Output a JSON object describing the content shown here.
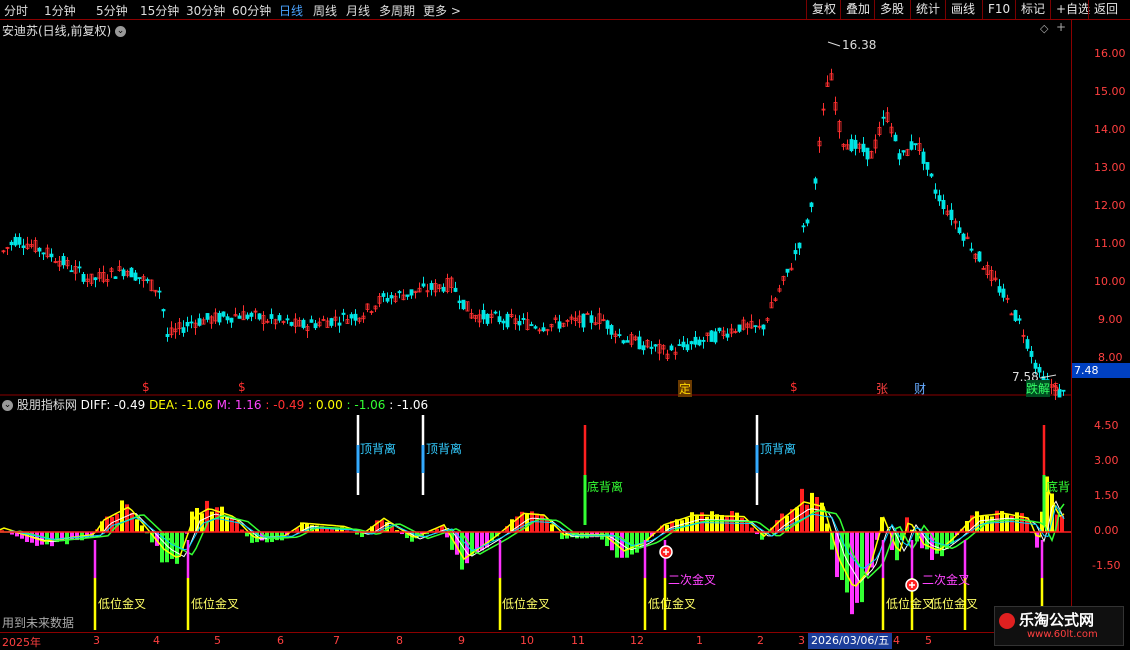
{
  "toolbar": {
    "periods": [
      "分时",
      "1分钟",
      "5分钟",
      "15分钟",
      "30分钟",
      "60分钟",
      "日线",
      "周线",
      "月线",
      "多周期",
      "更多"
    ],
    "active_period": "日线",
    "buttons": [
      "复权",
      "叠加",
      "多股",
      "统计",
      "画线",
      "F10",
      "标记",
      "+自选",
      "返回"
    ]
  },
  "main": {
    "title": "安迪苏(日线,前复权)",
    "high_label": "16.38",
    "low_label": "7.58",
    "last_price": "7.48",
    "y_ticks": [
      "16.00",
      "15.00",
      "14.00",
      "13.00",
      "12.00",
      "11.00",
      "10.00",
      "9.00",
      "8.00"
    ],
    "markers": [
      {
        "text": "$",
        "color": "#ff3030"
      },
      {
        "text": "$",
        "color": "#ff3030"
      },
      {
        "text": "定",
        "color": "#ffd700"
      },
      {
        "text": "$",
        "color": "#ff3030"
      },
      {
        "text": "张",
        "color": "#ff4040"
      },
      {
        "text": "财",
        "color": "#66aaff"
      },
      {
        "text": "跌解",
        "color": "#33ff66"
      },
      {
        "text": "$",
        "color": "#ff3030"
      }
    ]
  },
  "indicator": {
    "name": "股朋指标网",
    "diff_label": "DIFF: -0.49",
    "dea_label": "DEA: -1.06",
    "m_label": "M: 1.16",
    "v1": ": -0.49",
    "v2": ": 0.00",
    "v3": ": -1.06",
    "v4": ": -1.06",
    "y_ticks": [
      "4.50",
      "3.00",
      "1.50",
      "0.00",
      "-1.50"
    ],
    "labels": {
      "top_div": "顶背离",
      "bottom_div": "底背离",
      "low_cross": "低位金叉",
      "second_cross": "二次金叉"
    },
    "future_note": "用到未来数据"
  },
  "time_axis": {
    "year": "2025年",
    "months": [
      "3",
      "4",
      "5",
      "6",
      "7",
      "8",
      "9",
      "10",
      "11",
      "12",
      "1",
      "2",
      "3",
      "4",
      "5"
    ],
    "cursor_date": "2026/03/06/五"
  },
  "watermark": {
    "name": "乐淘公式网",
    "url": "www.60lt.com"
  },
  "colors": {
    "up": "#ff3030",
    "down": "#00e5e5",
    "frame": "#8b0000",
    "accent": "#4aa3ff"
  }
}
